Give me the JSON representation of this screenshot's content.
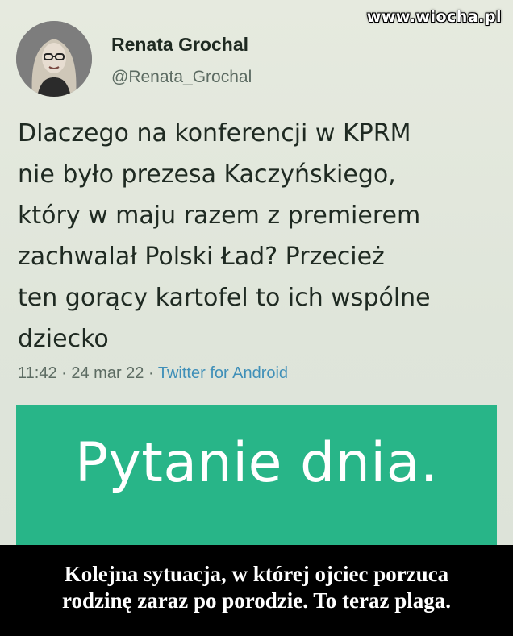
{
  "watermark": "www.wiocha.pl",
  "tweet": {
    "author_name": "Renata Grochal",
    "author_handle": "@Renata_Grochal",
    "text": "Dlaczego na konferencji w KPRM\nnie było prezesa Kaczyńskiego,\nktóry w maju razem z premierem\nzachwalał Polski Ład? Przecież\nten gorący kartofel to ich wspólne\ndziecko",
    "time": "11:42",
    "separator": "·",
    "date": "24 mar 22",
    "source": "Twitter for Android"
  },
  "card": {
    "title": "Pytanie dnia.",
    "background_color": "#28b588"
  },
  "caption": {
    "text": "Kolejna sytuacja, w której ojciec porzuca\nrodzinę zaraz po porodzie. To teraz plaga."
  }
}
